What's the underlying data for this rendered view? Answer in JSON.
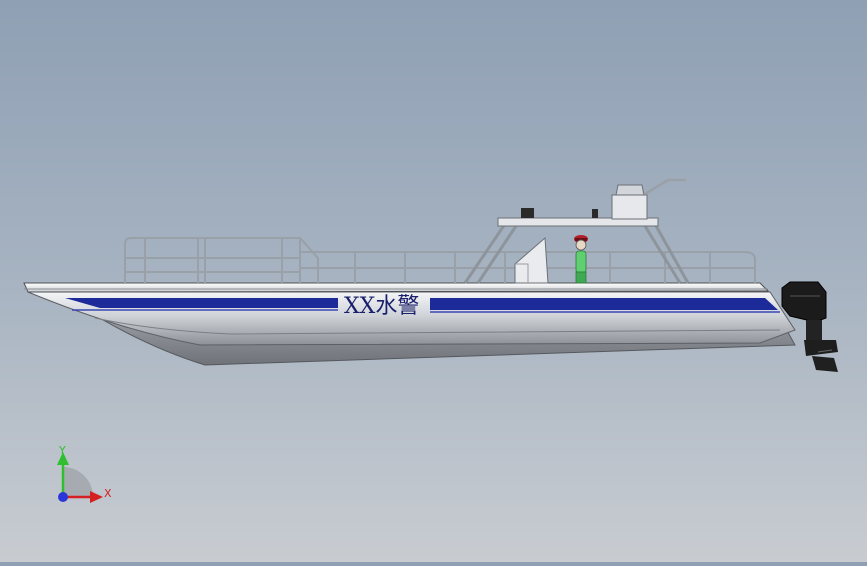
{
  "viewport": {
    "background_top": "#8fa0b4",
    "background_bottom": "#c8ccd1"
  },
  "model": {
    "hull_text": "XX水警",
    "stripe_color": "#1c2a9a",
    "hull_color": "#d9dde2",
    "engine_color": "#1b1b1b"
  },
  "triad": {
    "y_label": "Y",
    "x_label": "X",
    "y_color": "#2fbf2f",
    "x_color": "#d42020",
    "z_color": "#2a36d8"
  }
}
